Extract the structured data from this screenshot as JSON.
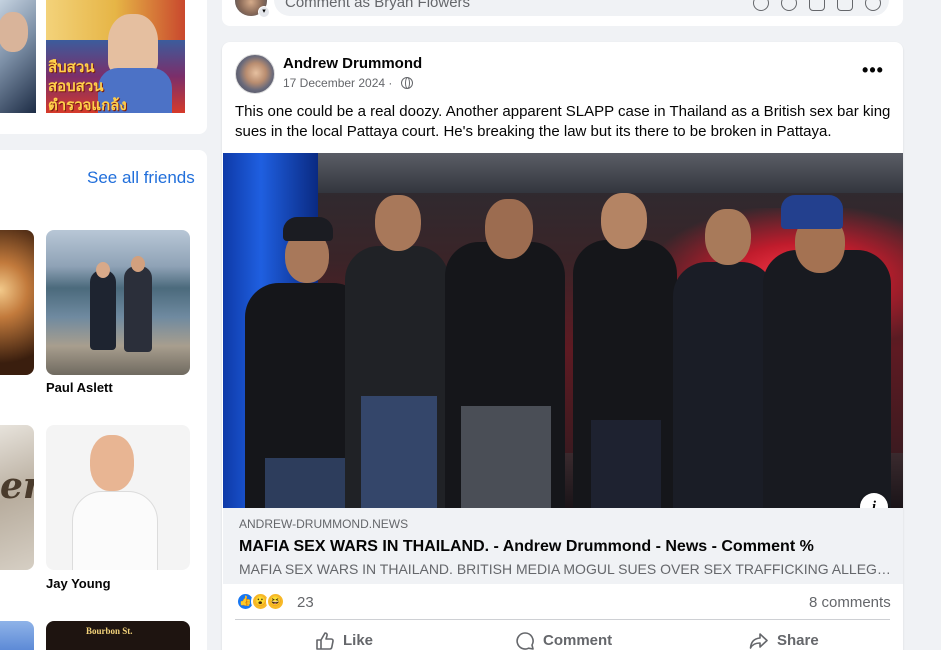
{
  "composer": {
    "placeholder": "Comment as Bryan Flowers",
    "icons": [
      "sticker-icon",
      "emoji-icon",
      "camera-icon",
      "gif-icon",
      "avatar-sticker-icon"
    ]
  },
  "sidebar": {
    "see_all_friends": "See all friends",
    "friends": [
      {
        "name": "Paul Aslett"
      },
      {
        "name": "Jay Young"
      }
    ],
    "partial_sign_text": "Bourbon St.",
    "partial_tile_text": "er",
    "photo_b_thai": "สืบสวนสอบสวน ตำรวจแกล้ง"
  },
  "post": {
    "author": "Andrew Drummond",
    "date": "17 December 2024 ·",
    "privacy_icon": "globe-icon",
    "more_label": "•••",
    "text": "This one could be a real doozy. Another apparent SLAPP case in Thailand as a British sex bar king sues in the local Pattaya court. He's breaking the law but its there to be broken in Pattaya.",
    "info_badge": "i",
    "link": {
      "domain": "ANDREW-DRUMMOND.NEWS",
      "title": "MAFIA SEX WARS IN THAILAND. - Andrew Drummond - News - Comment %",
      "description": "MAFIA SEX WARS IN THAILAND. BRITISH MEDIA MOGUL SUES OVER SEX TRAFFICKING ALLEG…"
    },
    "reactions": {
      "types": [
        "like",
        "wow",
        "haha"
      ],
      "count": "23",
      "comments": "8 comments"
    },
    "actions": {
      "like": "Like",
      "comment": "Comment",
      "share": "Share"
    }
  },
  "colors": {
    "link_blue": "#216fdb",
    "like_blue": "#1877f2",
    "secondary_text": "#65676b",
    "background": "#f0f2f5"
  }
}
